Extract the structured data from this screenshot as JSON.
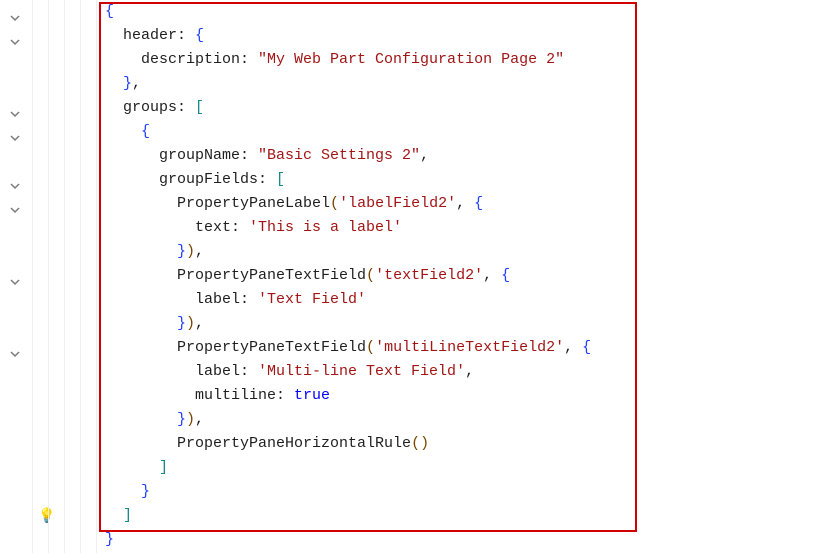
{
  "code": {
    "l1": "{",
    "l2a": "  header: ",
    "l2b": "{",
    "l3a": "    description: ",
    "l3b": "\"My Web Part Configuration Page 2\"",
    "l4": "  }",
    "l4c": ",",
    "l5a": "  groups: ",
    "l5b": "[",
    "l6": "    {",
    "l7a": "      groupName: ",
    "l7b": "\"Basic Settings 2\"",
    "l7c": ",",
    "l8a": "      groupFields: ",
    "l8b": "[",
    "l9a": "        PropertyPaneLabel",
    "l9p1": "(",
    "l9b": "'labelField2'",
    "l9c": ", ",
    "l9d": "{",
    "l10a": "          text: ",
    "l10b": "'This is a label'",
    "l11": "        }",
    "l11p": ")",
    "l11c": ",",
    "l12a": "        PropertyPaneTextField",
    "l12p1": "(",
    "l12b": "'textField2'",
    "l12c": ", ",
    "l12d": "{",
    "l13a": "          label: ",
    "l13b": "'Text Field'",
    "l14": "        }",
    "l14p": ")",
    "l14c": ",",
    "l15a": "        PropertyPaneTextField",
    "l15p1": "(",
    "l15b": "'multiLineTextField2'",
    "l15c": ", ",
    "l15d": "{",
    "l16a": "          label: ",
    "l16b": "'Multi-line Text Field'",
    "l16c": ",",
    "l17a": "          multiline: ",
    "l17b": "true",
    "l18": "        }",
    "l18p": ")",
    "l18c": ",",
    "l19a": "        PropertyPaneHorizontalRule",
    "l19p1": "(",
    "l19p2": ")",
    "l20": "      ]",
    "l21": "    }",
    "l22": "  ]",
    "l23": "}"
  },
  "gutter": {
    "chevrons": [
      1,
      2,
      5,
      6,
      8,
      9,
      12,
      15
    ],
    "bulb_line": 22
  }
}
